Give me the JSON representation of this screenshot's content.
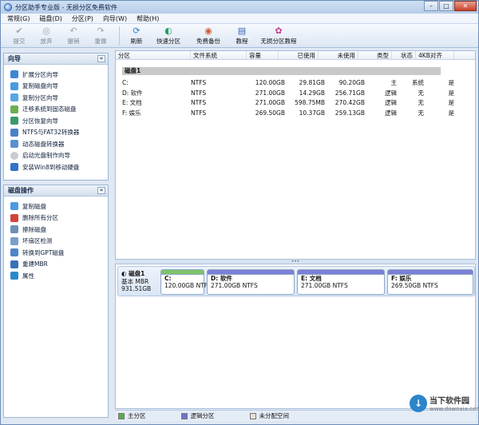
{
  "window": {
    "title": "分区助手专业版 - 无损分区免费软件",
    "minimize": "–",
    "maximize": "□",
    "close": "✕"
  },
  "menu": [
    "常规(G)",
    "磁盘(D)",
    "分区(P)",
    "向导(W)",
    "帮助(H)"
  ],
  "toolbar": [
    {
      "label": "提交",
      "icon": "check-icon",
      "glyph": "✔",
      "enabled": false
    },
    {
      "label": "放弃",
      "icon": "discard-icon",
      "glyph": "◎",
      "enabled": false
    },
    {
      "label": "撤销",
      "icon": "undo-icon",
      "glyph": "↶",
      "enabled": false
    },
    {
      "label": "重做",
      "icon": "redo-icon",
      "glyph": "↷",
      "enabled": false
    },
    {
      "label": "刷新",
      "icon": "refresh-icon",
      "glyph": "⟳",
      "enabled": true
    },
    {
      "label": "快速分区",
      "icon": "quick-partition-icon",
      "glyph": "◐",
      "enabled": true
    },
    {
      "label": "免费备份",
      "icon": "backup-icon",
      "glyph": "◉",
      "enabled": true
    },
    {
      "label": "教程",
      "icon": "tutorial-icon",
      "glyph": "▤",
      "enabled": true
    },
    {
      "label": "无损分区教程",
      "icon": "lossless-tutorial-icon",
      "glyph": "✿",
      "enabled": true
    }
  ],
  "wizard": {
    "title": "向导",
    "collapse": "«",
    "items": [
      "扩展分区向导",
      "复制磁盘向导",
      "复制分区向导",
      "迁移系统到固态磁盘",
      "分区恢复向导",
      "NTFS与FAT32转换器",
      "动态磁盘转换器",
      "启动光盘制作向导",
      "安装Win8到移动硬盘"
    ]
  },
  "diskops": {
    "title": "磁盘操作",
    "collapse": "«",
    "items": [
      "复制磁盘",
      "删除所有分区",
      "擦除磁盘",
      "坏扇区检测",
      "转换到GPT磁盘",
      "重建MBR",
      "属性"
    ]
  },
  "table": {
    "headers": [
      "分区",
      "文件系统",
      "容量",
      "已使用",
      "未使用",
      "类型",
      "状态",
      "4KB对齐"
    ],
    "disk_label": "磁盘1",
    "rows": [
      {
        "name": "C:",
        "fs": "NTFS",
        "cap": "120.00GB",
        "used": "29.81GB",
        "free": "90.20GB",
        "type": "主",
        "status": "系统",
        "align": "是"
      },
      {
        "name": "D: 软件",
        "fs": "NTFS",
        "cap": "271.00GB",
        "used": "14.29GB",
        "free": "256.71GB",
        "type": "逻辑",
        "status": "无",
        "align": "是"
      },
      {
        "name": "E: 文档",
        "fs": "NTFS",
        "cap": "271.00GB",
        "used": "598.75MB",
        "free": "270.42GB",
        "type": "逻辑",
        "status": "无",
        "align": "是"
      },
      {
        "name": "F: 娱乐",
        "fs": "NTFS",
        "cap": "269.50GB",
        "used": "10.37GB",
        "free": "259.13GB",
        "type": "逻辑",
        "status": "无",
        "align": "是"
      }
    ]
  },
  "splitter": "•••",
  "diskmap": {
    "name": "磁盘1",
    "kind": "基本 MBR",
    "size": "931.51GB",
    "parts": [
      {
        "label": "C:",
        "info": "120.00GB NTFS",
        "color": "#7fc36a"
      },
      {
        "label": "D: 软件",
        "info": "271.00GB NTFS",
        "color": "#7d7fd6"
      },
      {
        "label": "E: 文档",
        "info": "271.00GB NTFS",
        "color": "#7d7fd6"
      },
      {
        "label": "F: 娱乐",
        "info": "269.50GB NTFS",
        "color": "#7d7fd6"
      }
    ]
  },
  "legend": [
    {
      "label": "主分区",
      "color": "#5aae45"
    },
    {
      "label": "逻辑分区",
      "color": "#6f72cf"
    },
    {
      "label": "未分配空间",
      "color": "#e6e1d4"
    }
  ],
  "watermark": {
    "logo": "↓",
    "name": "当下软件园",
    "url": "www.downxia.com"
  }
}
